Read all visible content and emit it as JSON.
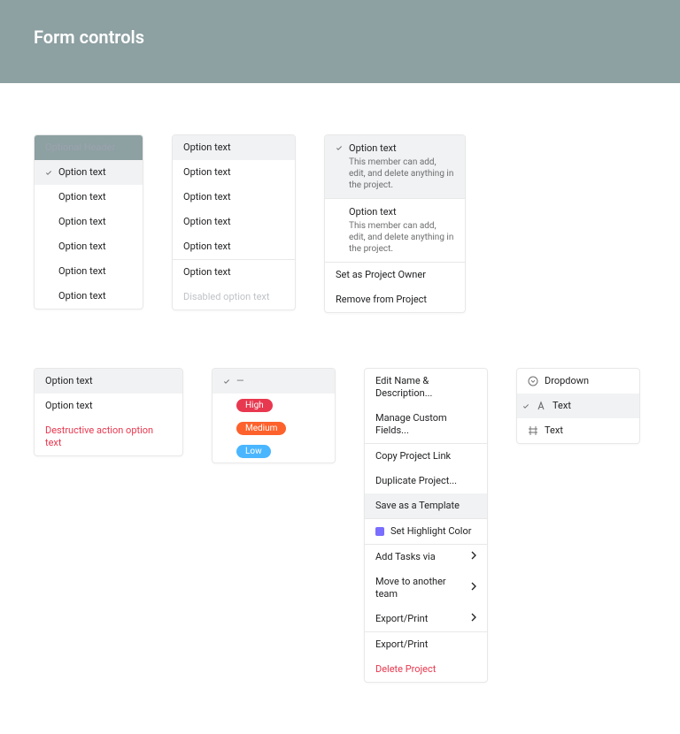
{
  "header": {
    "title": "Form controls"
  },
  "menu1": {
    "header": "Optional Header",
    "items": [
      "Option text",
      "Option text",
      "Option text",
      "Option text",
      "Option text",
      "Option text"
    ]
  },
  "menu2": {
    "items": [
      "Option text",
      "Option text",
      "Option text",
      "Option text",
      "Option text",
      "Option text"
    ],
    "disabled": "Disabled option text"
  },
  "menu3": {
    "items": [
      {
        "label": "Option text",
        "desc": "This member can add, edit, and delete anything in the project."
      },
      {
        "label": "Option text",
        "desc": "This member can add, edit, and delete anything in the project."
      }
    ],
    "extra": [
      "Set as Project Owner",
      "Remove from Project"
    ]
  },
  "menu4": {
    "header": "Option text",
    "items": [
      "Option text"
    ],
    "destructive": "Destructive action option text"
  },
  "menu5": {
    "selected": "—",
    "pills": [
      {
        "label": "High",
        "color": "#e8384f"
      },
      {
        "label": "Medium",
        "color": "#fd612c"
      },
      {
        "label": "Low",
        "color": "#4ab6ff"
      }
    ]
  },
  "menu6": {
    "g1": [
      "Edit Name & Description...",
      "Manage Custom Fields..."
    ],
    "g2": [
      "Copy Project Link",
      "Duplicate Project...",
      "Save as a Template"
    ],
    "highlight": "Set Highlight Color",
    "sub": [
      "Add Tasks via",
      "Move to another team",
      "Export/Print"
    ],
    "g3": [
      "Export/Print"
    ],
    "destructive": "Delete Project"
  },
  "menu7": {
    "items": [
      "Dropdown",
      "Text",
      "Text"
    ]
  }
}
